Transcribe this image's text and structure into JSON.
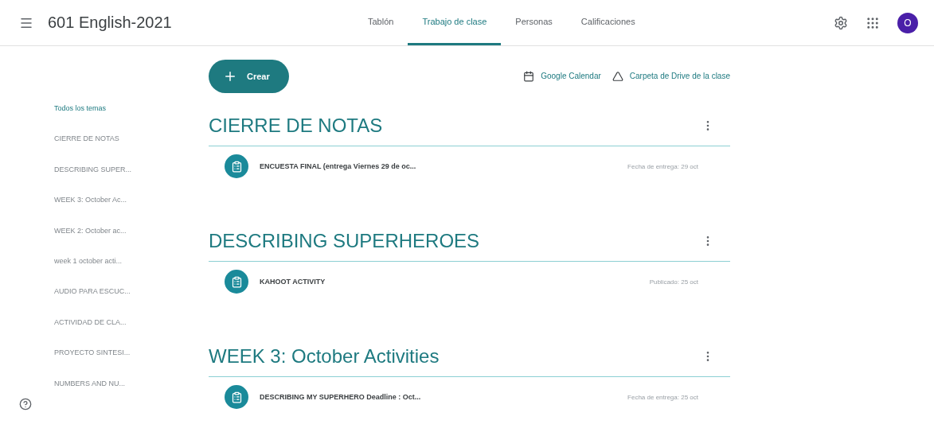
{
  "header": {
    "class_name": "601 English-2021",
    "tabs": [
      {
        "label": "Tablón",
        "selected": false
      },
      {
        "label": "Trabajo de clase",
        "selected": true
      },
      {
        "label": "Personas",
        "selected": false
      },
      {
        "label": "Calificaciones",
        "selected": false
      }
    ],
    "avatar": "O"
  },
  "toolbar": {
    "create": "Crear",
    "links": [
      {
        "kind": "calendar",
        "label": "Google Calendar"
      },
      {
        "kind": "drive",
        "label": "Carpeta de Drive de la clase"
      }
    ]
  },
  "sidebar": {
    "items": [
      {
        "label": "Todos los temas",
        "selected": true
      },
      {
        "label": "CIERRE DE NOTAS",
        "selected": false
      },
      {
        "label": "DESCRIBING SUPER...",
        "selected": false
      },
      {
        "label": "WEEK 3: October Ac...",
        "selected": false
      },
      {
        "label": "WEEK 2: October ac...",
        "selected": false
      },
      {
        "label": "week 1 october acti...",
        "selected": false
      },
      {
        "label": "AUDIO PARA ESCUC...",
        "selected": false
      },
      {
        "label": "ACTIVIDAD DE CLA...",
        "selected": false
      },
      {
        "label": "PROYECTO SINTESI...",
        "selected": false
      },
      {
        "label": "NUMBERS AND NU...",
        "selected": false
      }
    ]
  },
  "topics": [
    {
      "title": "CIERRE DE NOTAS",
      "items": [
        {
          "title": "ENCUESTA FINAL (entrega Viernes 29 de oc...",
          "date": "Fecha de entrega: 29 oct"
        }
      ]
    },
    {
      "title": "DESCRIBING SUPERHEROES",
      "items": [
        {
          "title": "KAHOOT ACTIVITY",
          "date": "Publicado: 25 oct"
        }
      ]
    },
    {
      "title": "WEEK 3: October Activities",
      "items": [
        {
          "title": "DESCRIBING MY SUPERHERO Deadline : Oct...",
          "date": "Fecha de entrega: 25 oct"
        }
      ]
    }
  ]
}
